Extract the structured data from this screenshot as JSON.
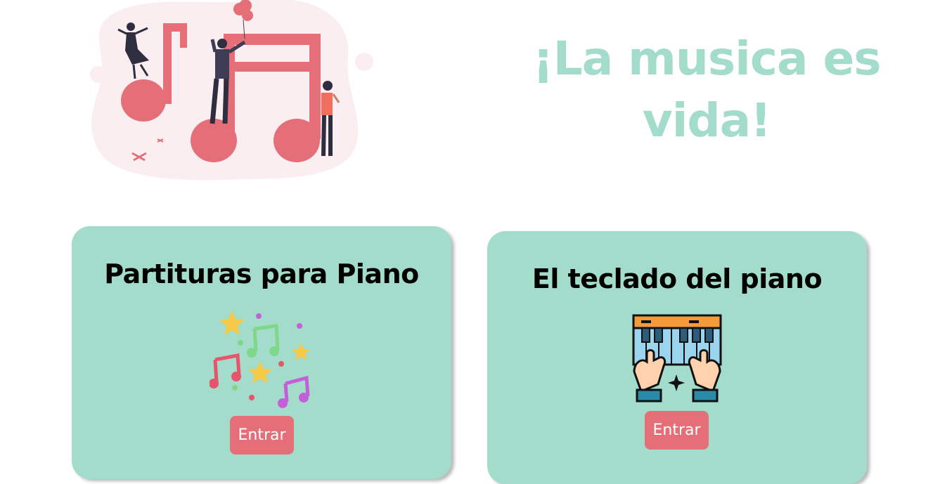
{
  "hero": {
    "title": "¡La musica es vida!"
  },
  "cards": [
    {
      "title": "Partituras para Piano",
      "icon": "music-notes-stars-icon",
      "button_label": "Entrar"
    },
    {
      "title": "El teclado del piano",
      "icon": "piano-keyboard-hands-icon",
      "button_label": "Entrar"
    }
  ],
  "colors": {
    "accent": "#a3dccb",
    "button": "#e46f79",
    "illustration": "#e46f79"
  }
}
